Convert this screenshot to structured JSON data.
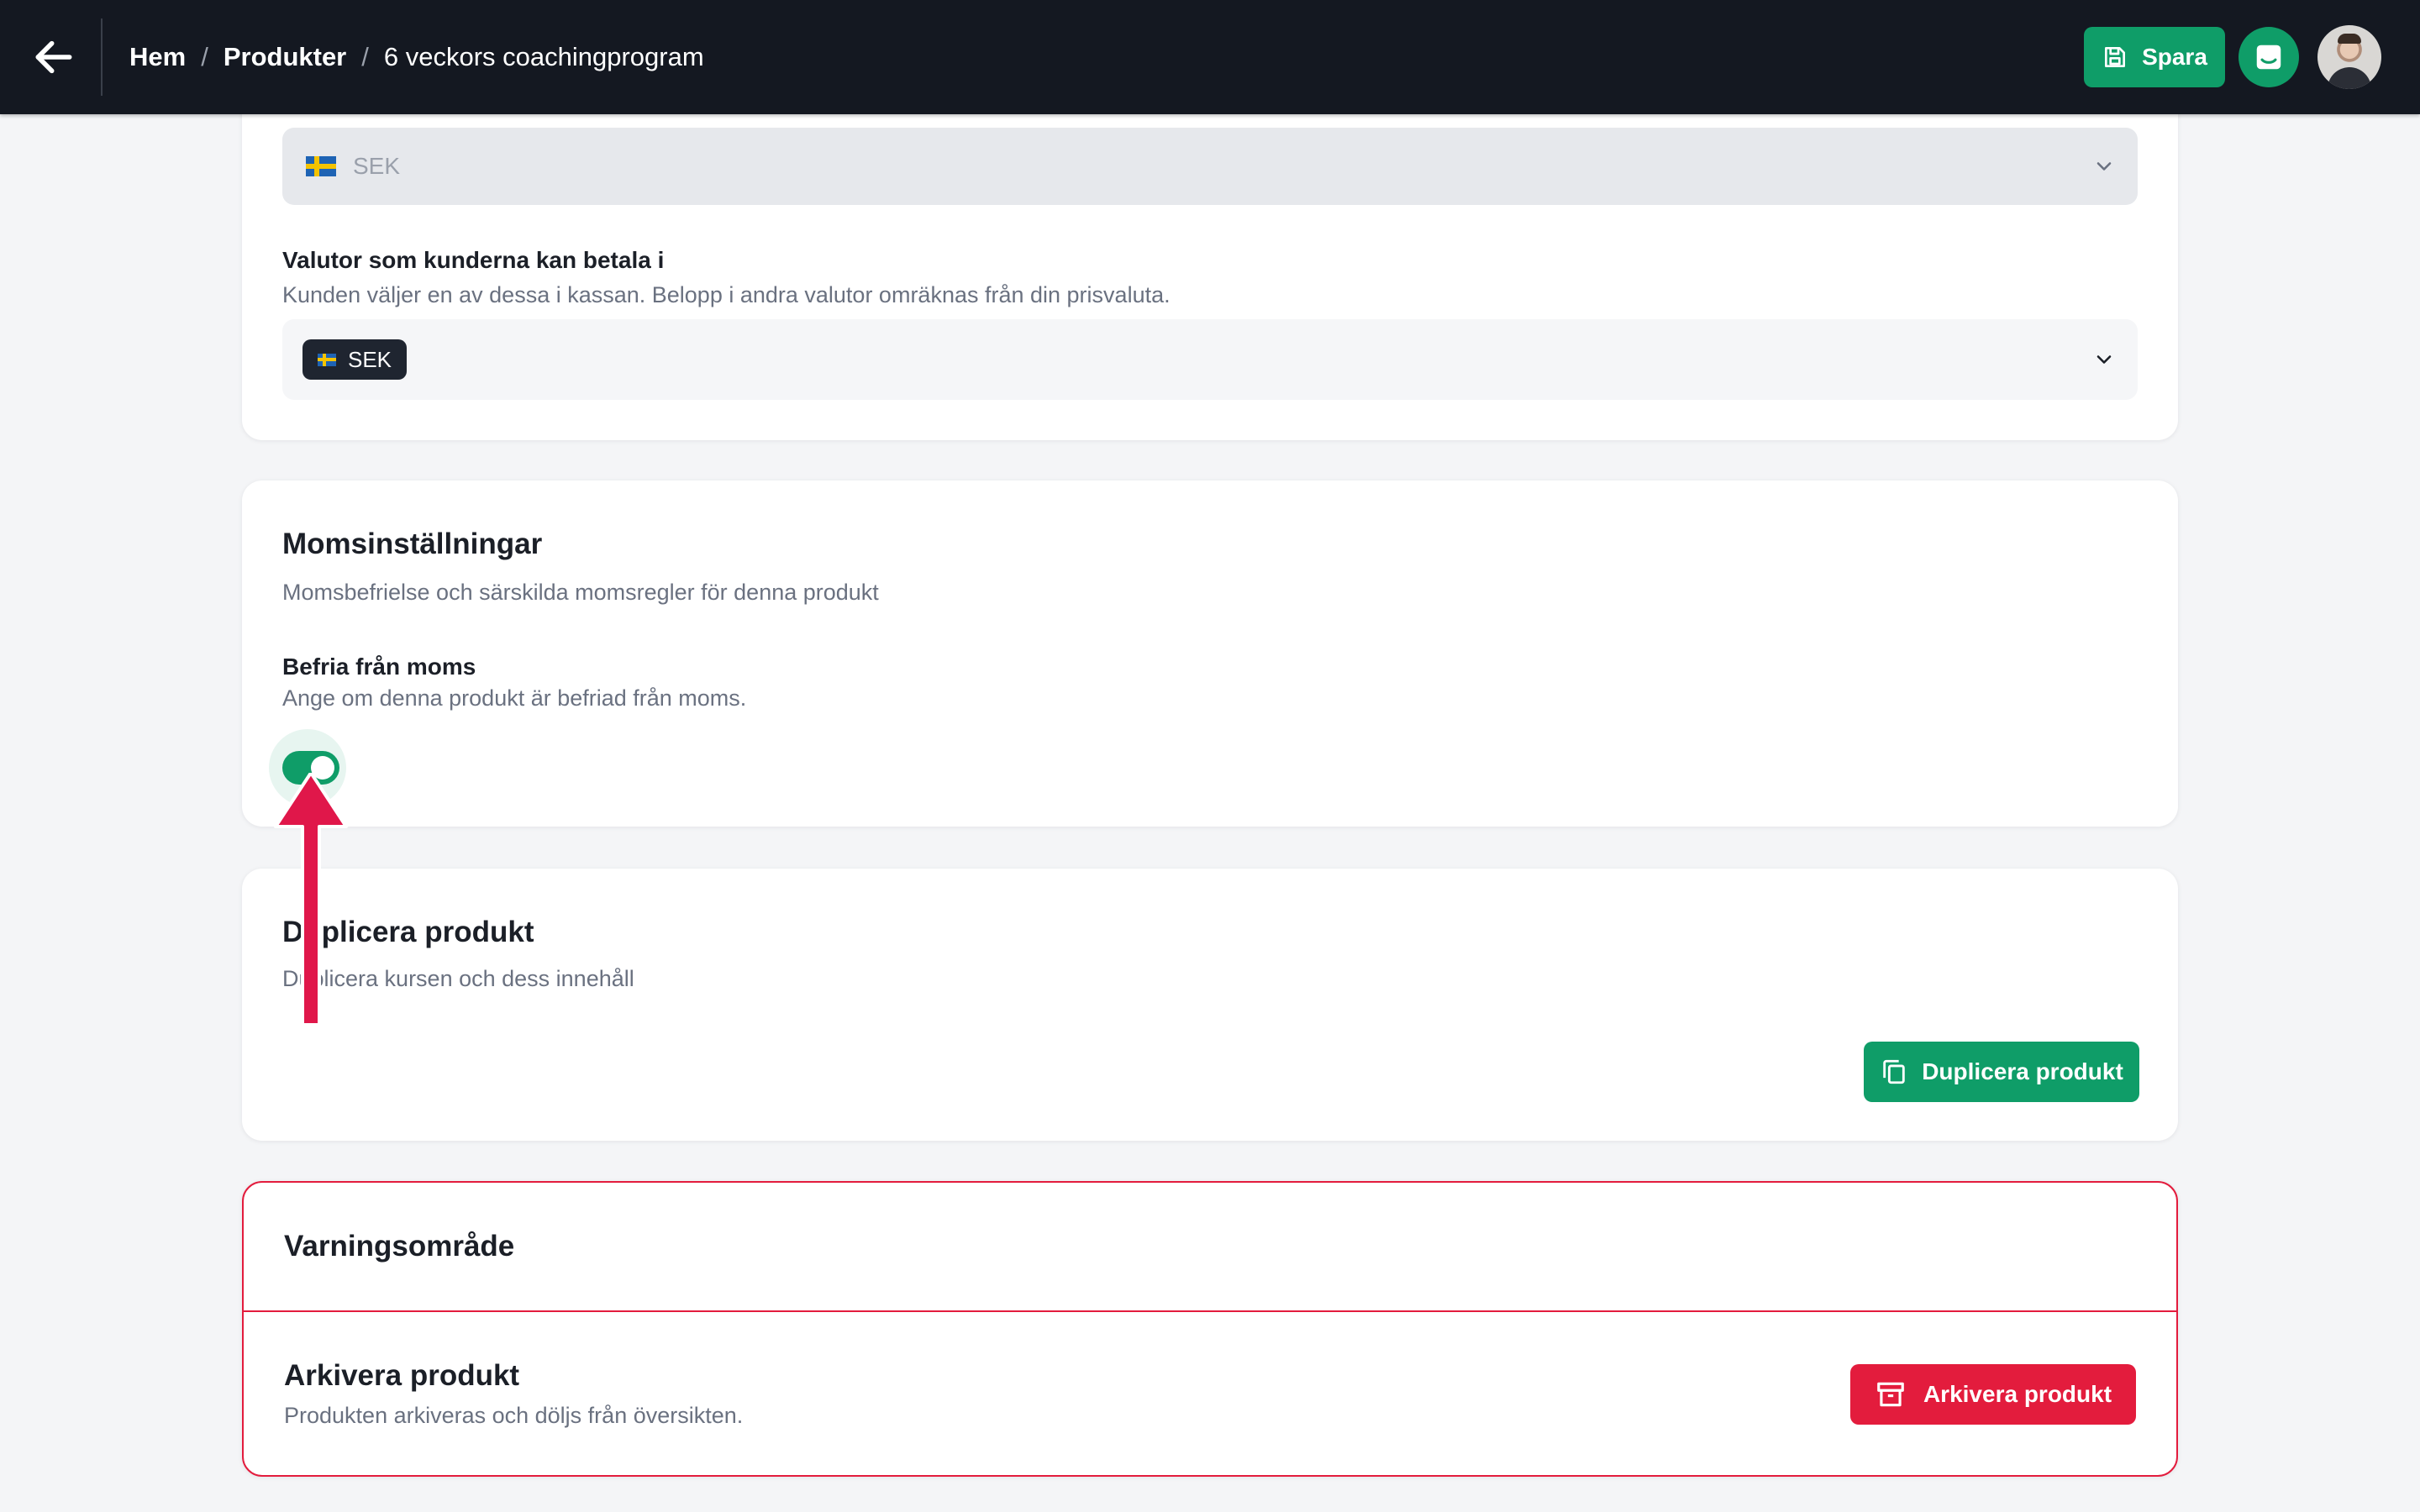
{
  "topbar": {
    "breadcrumb": {
      "home": "Hem",
      "separator1": "/",
      "products": "Produkter",
      "separator2": "/",
      "current": "6 veckors coachingprogram"
    },
    "save_label": "Spara",
    "icons": {
      "back": "arrow-left-icon",
      "save": "floppy-disk-icon",
      "chat": "chat-inbox-icon"
    }
  },
  "currency": {
    "price_currency_value": "SEK",
    "payment_currencies_label": "Valutor som kunderna kan betala i",
    "payment_currencies_help": "Kunden väljer en av dessa i kassan. Belopp i andra valutor omräknas från din prisvaluta.",
    "selected_chip": "SEK"
  },
  "vat": {
    "title": "Momsinställningar",
    "subtitle": "Momsbefrielse och särskilda momsregler för denna produkt",
    "exempt_label": "Befria från moms",
    "exempt_help": "Ange om denna produkt är befriad från moms.",
    "exempt_enabled": true
  },
  "duplicate": {
    "title": "Duplicera produkt",
    "subtitle": "Duplicera kursen och dess innehåll",
    "button_label": "Duplicera produkt",
    "icon": "copy-icon"
  },
  "danger_zone": {
    "title": "Varningsområde",
    "archive_title": "Arkivera produkt",
    "archive_help": "Produkten arkiveras och döljs från översikten.",
    "archive_button": "Arkivera produkt",
    "icon": "archive-box-icon"
  },
  "colors": {
    "topbar": "#141821",
    "primary_green": "#0f9d68",
    "danger_red": "#e31c3d",
    "annotation_arrow": "#e0174a"
  }
}
